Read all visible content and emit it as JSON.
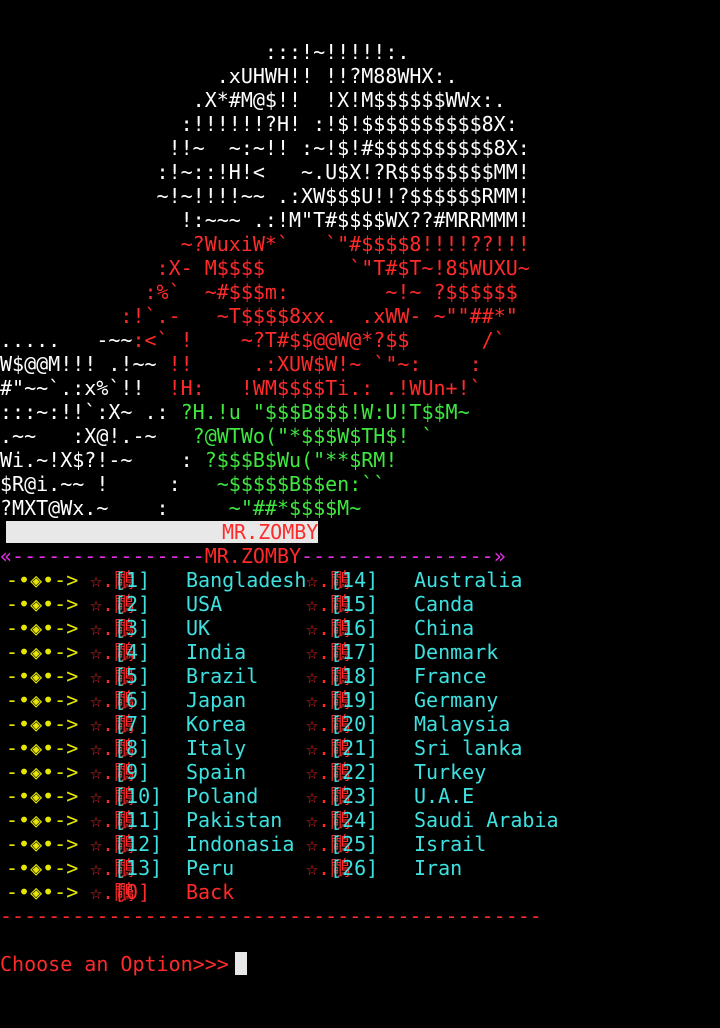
{
  "art_lines": [
    [
      {
        "t": "                      :::!~!!!!!:.",
        "c": "w"
      }
    ],
    [
      {
        "t": "                  .xUHWH!! !!?M88WHX:.",
        "c": "w"
      }
    ],
    [
      {
        "t": "                .X*#M@$!!  !X!M$$$$$$WWx:.",
        "c": "w"
      }
    ],
    [
      {
        "t": "               :!!!!!!?H! :!$!$$$$$$$$$$8X:",
        "c": "w"
      }
    ],
    [
      {
        "t": "              !!~  ~:~!! :~!$!#$$$$$$$$$$8X:",
        "c": "w"
      }
    ],
    [
      {
        "t": "             :!~::!H!<   ~.U$X!?R$$$$$$$$MM!",
        "c": "w"
      }
    ],
    [
      {
        "t": "             ~!~!!!!~~ .:XW$$$U!!?$$$$$$RMM!",
        "c": "w"
      }
    ],
    [
      {
        "t": "               !:~~~ .:!M\"T#$$$$WX??#MRRMMM!",
        "c": "w"
      }
    ],
    [
      {
        "t": "               ~?WuxiW*`   `\"#$$$$8!!!!??!!!",
        "c": "r"
      }
    ],
    [
      {
        "t": "             :X- M$$$$       `\"T#$T~!8$WUXU~",
        "c": "r"
      }
    ],
    [
      {
        "t": "            :%`  ~#$$$m:        ~!~ ?$$$$$$",
        "c": "r"
      }
    ],
    [
      {
        "t": "          :!`.-   ~T$$$$8xx.  .xWW- ~\"\"##*\"",
        "c": "r"
      }
    ],
    [
      {
        "t": ".....   -~~",
        "c": "w"
      },
      {
        "t": ":<` !    ~?T#$$@@W@*?$$      /`",
        "c": "r"
      }
    ],
    [
      {
        "t": "W$@@M!!! .!~~ ",
        "c": "w"
      },
      {
        "t": "!!     .:XUW$W!~ `\"~:    :",
        "c": "r"
      }
    ],
    [
      {
        "t": "#\"~~`.:x%`!!  ",
        "c": "w"
      },
      {
        "t": "!H:   !WM$$$$Ti.: .!WUn+!`",
        "c": "r"
      }
    ],
    [
      {
        "t": ":::~:!!`:X~ .: ",
        "c": "w"
      },
      {
        "t": "?H.!u \"$$$B$$$!W:U!T$$M~",
        "c": "g"
      }
    ],
    [
      {
        "t": ".~~   :X@!.-~   ",
        "c": "w"
      },
      {
        "t": "?@WTWo(\"*$$$W$TH$! `",
        "c": "g"
      }
    ],
    [
      {
        "t": "Wi.~!X$?!-~    : ",
        "c": "w"
      },
      {
        "t": "?$$$B$Wu(\"**$RM!",
        "c": "g"
      }
    ],
    [
      {
        "t": "$R@i.~~ !     :   ",
        "c": "w"
      },
      {
        "t": "~$$$$$B$$en:``",
        "c": "g"
      }
    ],
    [
      {
        "t": "?MXT@Wx.~    :     ",
        "c": "w"
      },
      {
        "t": "~\"##*$$$$M~",
        "c": "g"
      }
    ]
  ],
  "banner": {
    "title": "MR.ZOMBY"
  },
  "separator": {
    "left": "«----------------",
    "title": "MR.ZOMBY",
    "right": "----------------»"
  },
  "menu": {
    "arrow": "-•◈•->",
    "mark": "☆.鷼",
    "left": [
      {
        "num": "[1]",
        "name": "Bangladesh"
      },
      {
        "num": "[2]",
        "name": "USA"
      },
      {
        "num": "[3]",
        "name": "UK"
      },
      {
        "num": "[4]",
        "name": "India"
      },
      {
        "num": "[5]",
        "name": "Brazil"
      },
      {
        "num": "[6]",
        "name": "Japan"
      },
      {
        "num": "[7]",
        "name": "Korea"
      },
      {
        "num": "[8]",
        "name": "Italy"
      },
      {
        "num": "[9]",
        "name": "Spain"
      },
      {
        "num": "[10]",
        "name": "Poland"
      },
      {
        "num": "[11]",
        "name": "Pakistan"
      },
      {
        "num": "[12]",
        "name": "Indonasia"
      },
      {
        "num": "[13]",
        "name": "Peru"
      }
    ],
    "right": [
      {
        "num": "[14]",
        "name": "Australia"
      },
      {
        "num": "[15]",
        "name": "Canda"
      },
      {
        "num": "[16]",
        "name": "China"
      },
      {
        "num": "[17]",
        "name": "Denmark"
      },
      {
        "num": "[18]",
        "name": "France"
      },
      {
        "num": "[19]",
        "name": "Germany"
      },
      {
        "num": "[20]",
        "name": "Malaysia"
      },
      {
        "num": "[21]",
        "name": "Sri lanka"
      },
      {
        "num": "[22]",
        "name": "Turkey"
      },
      {
        "num": "[23]",
        "name": "U.A.E"
      },
      {
        "num": "[24]",
        "name": "Saudi Arabia"
      },
      {
        "num": "[25]",
        "name": "Israil"
      },
      {
        "num": "[26]",
        "name": "Iran"
      }
    ],
    "back": {
      "num": "[0]",
      "name": "Back"
    }
  },
  "divider": "---------------------------------------------",
  "prompt": {
    "text": "Choose an Option>>>"
  },
  "colors": {
    "background": "#000000",
    "red": "#ff2a2a",
    "green": "#3ee83e",
    "cyan": "#3ee0e0",
    "yellow": "#e6e600",
    "magenta": "#e62ee6",
    "white": "#ffffff"
  }
}
